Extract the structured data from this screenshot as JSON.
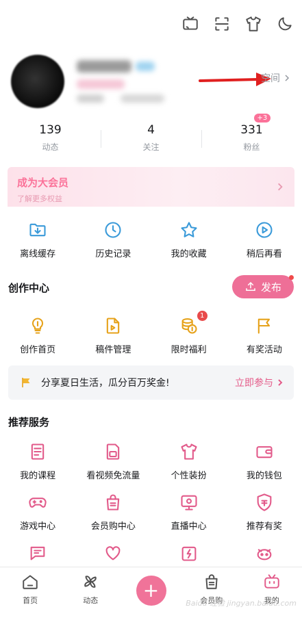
{
  "header": {
    "icons": [
      "tv-cast-icon",
      "scan-icon",
      "tshirt-icon",
      "moon-icon"
    ]
  },
  "profile": {
    "space_label": "空间"
  },
  "stats": [
    {
      "value": "139",
      "label": "动态"
    },
    {
      "value": "4",
      "label": "关注"
    },
    {
      "value": "331",
      "label": "粉丝",
      "badge": "+3"
    }
  ],
  "vip": {
    "title": "成为大会员",
    "subtitle": "了解更多权益"
  },
  "quick": [
    {
      "label": "离线缓存",
      "icon": "download-folder-icon"
    },
    {
      "label": "历史记录",
      "icon": "history-clock-icon"
    },
    {
      "label": "我的收藏",
      "icon": "star-icon"
    },
    {
      "label": "稍后再看",
      "icon": "watch-later-icon"
    }
  ],
  "creation": {
    "title": "创作中心",
    "publish_label": "发布",
    "items": [
      {
        "label": "创作首页",
        "icon": "bulb-icon"
      },
      {
        "label": "稿件管理",
        "icon": "manuscript-icon"
      },
      {
        "label": "限时福利",
        "icon": "coins-icon",
        "badge": "1"
      },
      {
        "label": "有奖活动",
        "icon": "flag-icon"
      }
    ]
  },
  "banner": {
    "text": "分享夏日生活，瓜分百万奖金!",
    "action": "立即参与"
  },
  "services": {
    "title": "推荐服务",
    "items": [
      {
        "label": "我的课程",
        "icon": "course-book-icon"
      },
      {
        "label": "看视频免流量",
        "icon": "sim-card-icon"
      },
      {
        "label": "个性装扮",
        "icon": "tshirt-icon"
      },
      {
        "label": "我的钱包",
        "icon": "wallet-icon"
      },
      {
        "label": "游戏中心",
        "icon": "gamepad-icon"
      },
      {
        "label": "会员购中心",
        "icon": "shopping-bag-icon"
      },
      {
        "label": "直播中心",
        "icon": "live-tv-icon"
      },
      {
        "label": "推荐有奖",
        "icon": "award-badge-icon"
      }
    ],
    "partial_row_icons": [
      "chat-icon",
      "heart-hands-icon",
      "charge-box-icon",
      "mascot-icon"
    ]
  },
  "bottom_nav": [
    {
      "label": "首页",
      "icon": "home-icon"
    },
    {
      "label": "动态",
      "icon": "pinwheel-icon"
    },
    {
      "label": "",
      "icon": "plus-icon"
    },
    {
      "label": "会员购",
      "icon": "shopping-bag-icon"
    },
    {
      "label": "我的",
      "icon": "bilibili-tv-icon"
    }
  ],
  "watermark": "Baidu 经验 jingyan.baidu.com",
  "colors": {
    "accent_pink": "#fb7299",
    "blue_icon": "#3a9ad9",
    "gold_icon": "#e6a21a",
    "arrow_red": "#e02020"
  }
}
